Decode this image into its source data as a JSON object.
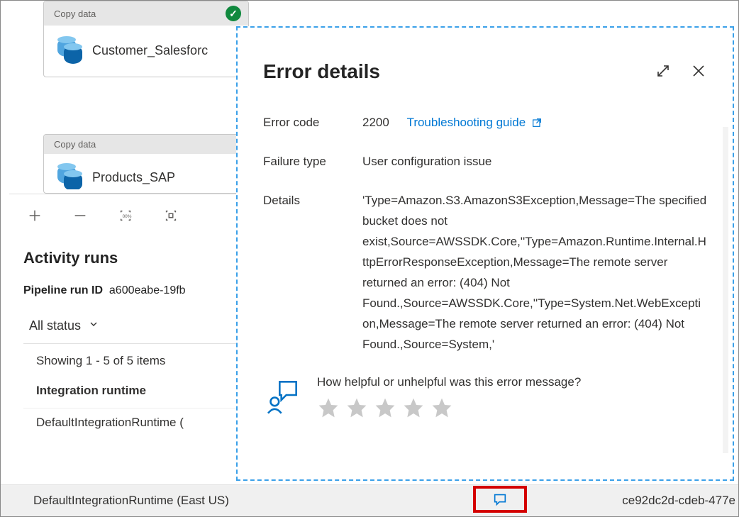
{
  "cards": {
    "copy_label": "Copy data",
    "name1": "Customer_Salesforc",
    "name2": "Products_SAP"
  },
  "runs": {
    "title": "Activity runs",
    "pipeline_label": "Pipeline run ID",
    "pipeline_id": "a600eabe-19fb",
    "filter": "All status",
    "showing": "Showing 1 - 5 of 5 items",
    "col_header": "Integration runtime",
    "row1": "DefaultIntegrationRuntime (",
    "bottom_row": "DefaultIntegrationRuntime (East US)",
    "right_id": "ce92dc2d-cdeb-477e"
  },
  "panel": {
    "title": "Error details",
    "error_code_label": "Error code",
    "error_code": "2200",
    "guide_link": "Troubleshooting guide",
    "failure_label": "Failure type",
    "failure_value": "User configuration issue",
    "details_label": "Details",
    "details_text": "'Type=Amazon.S3.AmazonS3Exception,Message=The specified bucket does not exist,Source=AWSSDK.Core,''Type=Amazon.Runtime.Internal.HttpErrorResponseException,Message=The remote server returned an error: (404) Not Found.,Source=AWSSDK.Core,''Type=System.Net.WebException,Message=The remote server returned an error: (404) Not Found.,Source=System,'",
    "feedback_q": "How helpful or unhelpful was this error message?"
  }
}
